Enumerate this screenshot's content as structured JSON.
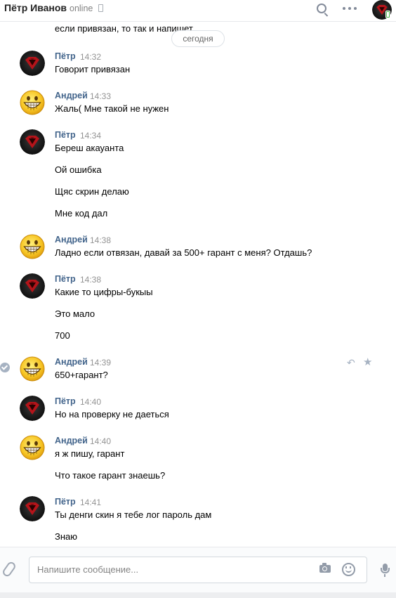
{
  "header": {
    "title": "Пётр Иванов",
    "status": "online"
  },
  "date_divider": "сегодня",
  "clipped_message": "если привязан, то так и напишет",
  "messages": [
    {
      "author": "Пётр",
      "time": "14:32",
      "lines": [
        "Говорит привязан"
      ]
    },
    {
      "author": "Андрей",
      "time": "14:33",
      "lines": [
        "Жаль( Мне такой не нужен"
      ]
    },
    {
      "author": "Пётр",
      "time": "14:34",
      "lines": [
        "Береш акауанта",
        "Ой ошибка",
        "Щяс скрин делаю",
        "Мне код дал"
      ]
    },
    {
      "author": "Андрей",
      "time": "14:38",
      "lines": [
        "Ладно если отвязан, давай за 500+ гарант с меня? Отдашь?"
      ]
    },
    {
      "author": "Пётр",
      "time": "14:38",
      "lines": [
        "Какие то цифры-букыы",
        "Это мало",
        "700"
      ]
    },
    {
      "author": "Андрей",
      "time": "14:39",
      "lines": [
        "650+гарант?"
      ]
    },
    {
      "author": "Пётр",
      "time": "14:40",
      "lines": [
        "Но на проверку не даеться"
      ]
    },
    {
      "author": "Андрей",
      "time": "14:40",
      "lines": [
        "я ж пишу, гарант",
        "Что такое гарант знаешь?"
      ]
    },
    {
      "author": "Пётр",
      "time": "14:41",
      "lines": [
        "Ты денги скин я тебе лог пароль дам",
        "Знаю"
      ]
    }
  ],
  "composer": {
    "placeholder": "Напишите сообщение..."
  },
  "colors": {
    "author": "#42648b",
    "accent": "#4a76a8",
    "online": "#4bb34b"
  },
  "icons": [
    "phone-icon",
    "search-icon",
    "more-icon",
    "check-icon",
    "reply-icon",
    "star-icon",
    "paperclip-icon",
    "camera-icon",
    "smile-icon",
    "mic-icon"
  ]
}
